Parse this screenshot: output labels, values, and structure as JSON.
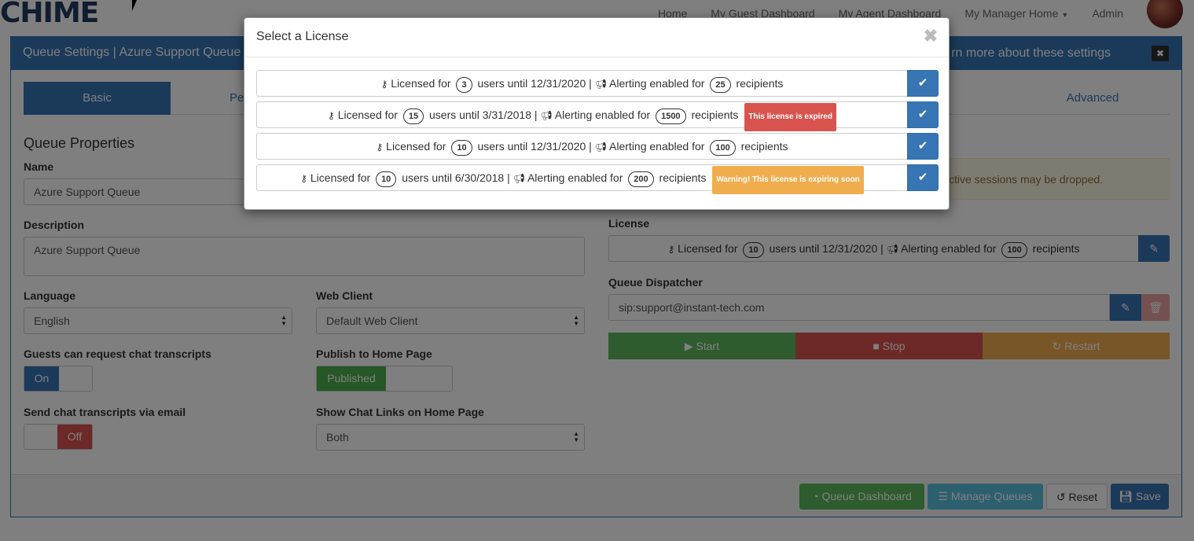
{
  "nav": {
    "logo": "CHIME",
    "links": [
      "Home",
      "My Guest Dashboard",
      "My Agent Dashboard",
      "My Manager Home",
      "Admin"
    ]
  },
  "panel": {
    "title": "Queue Settings | Azure Support Queue",
    "learn_more": "rn more about these settings",
    "close": "✖",
    "tabs": {
      "basic": "Basic",
      "pe": "Pe",
      "advanced": "Advanced"
    },
    "section_title": "Queue Properties",
    "name": {
      "label": "Name",
      "value": "Azure Support Queue"
    },
    "description": {
      "label": "Description",
      "value": "Azure Support Queue"
    },
    "language": {
      "label": "Language",
      "value": "English"
    },
    "web_client": {
      "label": "Web Client",
      "value": "Default Web Client"
    },
    "guests_transcripts": {
      "label": "Guests can request chat transcripts",
      "state": "On"
    },
    "publish_home": {
      "label": "Publish to Home Page",
      "state": "Published"
    },
    "send_transcripts": {
      "label": "Send chat transcripts via email",
      "state": "Off"
    },
    "show_links": {
      "label": "Show Chat Links on Home Page",
      "value": "Both"
    },
    "warning": "ctive sessions may be dropped.",
    "license": {
      "label": "License",
      "prefix": "Licensed for",
      "users": "10",
      "mid": "users until 12/31/2020 |",
      "alert": "Alerting enabled for",
      "recipients": "100",
      "suffix": "recipients"
    },
    "dispatcher": {
      "label": "Queue Dispatcher",
      "value": "sip:support@instant-tech.com"
    },
    "controls": {
      "start": "Start",
      "stop": "Stop",
      "restart": "Restart"
    },
    "footer": {
      "dashboard": "Queue Dashboard",
      "manage": "Manage Queues",
      "reset": "Reset",
      "save": "Save"
    }
  },
  "modal": {
    "title": "Select a License",
    "close": "✖",
    "licenses": [
      {
        "prefix": "Licensed for",
        "users": "3",
        "until": "users until 12/31/2020 |",
        "alert": "Alerting enabled for",
        "recipients": "25",
        "suffix": "recipients",
        "tag": "",
        "tag_type": ""
      },
      {
        "prefix": "Licensed for",
        "users": "15",
        "until": "users until 3/31/2018 |",
        "alert": "Alerting enabled for",
        "recipients": "1500",
        "suffix": "recipients",
        "tag": "This license is expired",
        "tag_type": "red"
      },
      {
        "prefix": "Licensed for",
        "users": "10",
        "until": "users until 12/31/2020 |",
        "alert": "Alerting enabled for",
        "recipients": "100",
        "suffix": "recipients",
        "tag": "",
        "tag_type": ""
      },
      {
        "prefix": "Licensed for",
        "users": "10",
        "until": "users until 6/30/2018 |",
        "alert": "Alerting enabled for",
        "recipients": "200",
        "suffix": "recipients",
        "tag": "Warning! This license is expiring soon",
        "tag_type": "orange"
      }
    ]
  },
  "colors": {
    "primary": "#3775b5",
    "success": "#4cae4c",
    "danger": "#d9534f",
    "warning": "#f0ad4e",
    "info": "#5bc0de"
  }
}
